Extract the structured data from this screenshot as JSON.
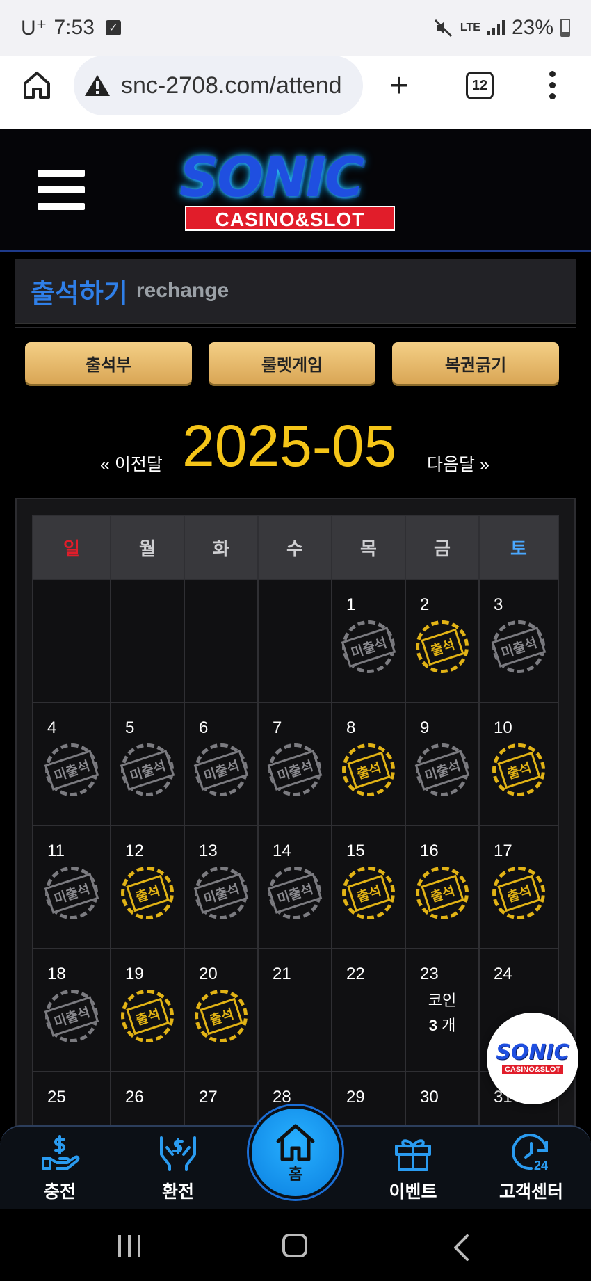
{
  "status_bar": {
    "carrier": "U⁺",
    "time": "7:53",
    "network": "LTE",
    "battery": "23%"
  },
  "browser": {
    "url": "snc-2708.com/attend",
    "tab_count": "12"
  },
  "logo": {
    "main": "SONIC",
    "sub": "CASINO&SLOT"
  },
  "page": {
    "title_ko": "출석하기",
    "title_en": "rechange"
  },
  "tabs": [
    {
      "label": "출석부"
    },
    {
      "label": "룰렛게임"
    },
    {
      "label": "복권긁기"
    }
  ],
  "calendar": {
    "prev_label": "« 이전달",
    "next_label": "다음달 »",
    "month": "2025-05",
    "weekdays": [
      "일",
      "월",
      "화",
      "수",
      "목",
      "금",
      "토"
    ],
    "stamp_yes": "출석",
    "stamp_no": "미출석",
    "coin_label": "코인",
    "coin_count": "3",
    "coin_unit": "개",
    "weeks": [
      [
        null,
        null,
        null,
        null,
        {
          "day": "1",
          "status": "no"
        },
        {
          "day": "2",
          "status": "yes"
        },
        {
          "day": "3",
          "status": "no"
        }
      ],
      [
        {
          "day": "4",
          "status": "no"
        },
        {
          "day": "5",
          "status": "no"
        },
        {
          "day": "6",
          "status": "no"
        },
        {
          "day": "7",
          "status": "no"
        },
        {
          "day": "8",
          "status": "yes"
        },
        {
          "day": "9",
          "status": "no"
        },
        {
          "day": "10",
          "status": "yes"
        }
      ],
      [
        {
          "day": "11",
          "status": "no"
        },
        {
          "day": "12",
          "status": "yes"
        },
        {
          "day": "13",
          "status": "no"
        },
        {
          "day": "14",
          "status": "no"
        },
        {
          "day": "15",
          "status": "yes"
        },
        {
          "day": "16",
          "status": "yes"
        },
        {
          "day": "17",
          "status": "yes"
        }
      ],
      [
        {
          "day": "18",
          "status": "no"
        },
        {
          "day": "19",
          "status": "yes"
        },
        {
          "day": "20",
          "status": "yes"
        },
        {
          "day": "21",
          "status": ""
        },
        {
          "day": "22",
          "status": ""
        },
        {
          "day": "23",
          "status": "coin"
        },
        {
          "day": "24",
          "status": ""
        }
      ],
      [
        {
          "day": "25",
          "status": ""
        },
        {
          "day": "26",
          "status": ""
        },
        {
          "day": "27",
          "status": ""
        },
        {
          "day": "28",
          "status": ""
        },
        {
          "day": "29",
          "status": ""
        },
        {
          "day": "30",
          "status": ""
        },
        {
          "day": "31",
          "status": ""
        }
      ]
    ]
  },
  "floating_logo": {
    "main": "SONIC",
    "sub": "CASINO&SLOT"
  },
  "bottom_nav": [
    {
      "label": "충전",
      "icon": "deposit-icon"
    },
    {
      "label": "환전",
      "icon": "exchange-icon"
    },
    {
      "label": "홈",
      "icon": "home-icon"
    },
    {
      "label": "이벤트",
      "icon": "gift-icon"
    },
    {
      "label": "고객센터",
      "icon": "support-24-icon"
    }
  ],
  "colors": {
    "accent_gold": "#f5c518",
    "title_blue": "#2f7fe8",
    "sunday": "#e11d2a",
    "saturday": "#4aa8ff"
  }
}
